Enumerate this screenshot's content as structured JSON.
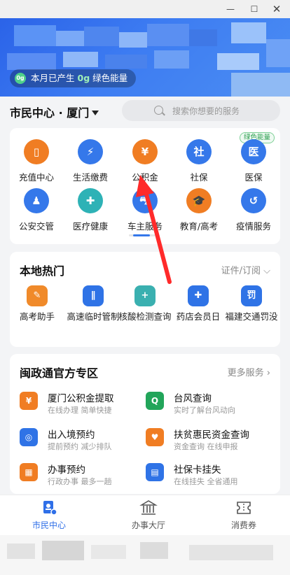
{
  "window": {
    "controls": [
      "minimize",
      "maximize",
      "close"
    ]
  },
  "banner": {
    "energy_text_prefix": "本月已产生",
    "energy_value": "0g",
    "energy_text_suffix": "绿色能量",
    "leaf_label": "0g"
  },
  "location": {
    "city": "市民中心 · 厦门"
  },
  "search": {
    "placeholder": "搜索你想要的服务"
  },
  "services": {
    "badge": "绿色能量",
    "items": [
      {
        "label": "充值中心",
        "icon": "phone-icon",
        "glyph": "▯"
      },
      {
        "label": "生活缴费",
        "icon": "lightning-icon",
        "glyph": "⚡"
      },
      {
        "label": "公积金",
        "icon": "house-yen-icon",
        "glyph": "¥"
      },
      {
        "label": "社保",
        "icon": "shield-icon",
        "glyph": "社"
      },
      {
        "label": "医保",
        "icon": "medical-shield-icon",
        "glyph": "医"
      },
      {
        "label": "公安交管",
        "icon": "police-icon",
        "glyph": "♟"
      },
      {
        "label": "医疗健康",
        "icon": "heart-plus-icon",
        "glyph": "✚"
      },
      {
        "label": "车主服务",
        "icon": "car-icon",
        "glyph": "⛍"
      },
      {
        "label": "教育/高考",
        "icon": "graduation-cap-icon",
        "glyph": "🎓"
      },
      {
        "label": "疫情服务",
        "icon": "clock-refresh-icon",
        "glyph": "↺"
      }
    ]
  },
  "local_hot": {
    "title": "本地热门",
    "filter": "证件/订阅",
    "items": [
      {
        "label": "高考助手",
        "icon": "exam-notes-icon",
        "glyph": "✎"
      },
      {
        "label": "高速临时管制",
        "icon": "highway-icon",
        "glyph": "∥"
      },
      {
        "label": "核酸检测查询",
        "icon": "test-heart-icon",
        "glyph": "+"
      },
      {
        "label": "药店会员日",
        "icon": "pharmacy-icon",
        "glyph": "✚"
      },
      {
        "label": "福建交通罚没",
        "icon": "fine-ticket-icon",
        "glyph": "罚"
      }
    ]
  },
  "official": {
    "title": "闽政通官方专区",
    "more": "更多服务",
    "items": [
      {
        "title": "厦门公积金提取",
        "sub": "在线办理 简单快捷",
        "icon": "provident-fund-icon",
        "glyph": "¥"
      },
      {
        "title": "台风查询",
        "sub": "实时了解台风动向",
        "icon": "typhoon-search-icon",
        "glyph": "Q"
      },
      {
        "title": "出入境预约",
        "sub": "提前预约 减少排队",
        "icon": "passport-icon",
        "glyph": "◎"
      },
      {
        "title": "扶贫惠民资金查询",
        "sub": "资金查询 在线申报",
        "icon": "poverty-aid-icon",
        "glyph": "♥"
      },
      {
        "title": "办事预约",
        "sub": "行政办事 最多一趟",
        "icon": "calendar-icon",
        "glyph": "▦"
      },
      {
        "title": "社保卡挂失",
        "sub": "在线挂失 全省通用",
        "icon": "card-search-icon",
        "glyph": "▤"
      }
    ]
  },
  "tabbar": {
    "tabs": [
      {
        "label": "市民中心",
        "icon": "citizen-center-icon",
        "active": true
      },
      {
        "label": "办事大厅",
        "icon": "government-hall-icon",
        "active": false
      },
      {
        "label": "消费券",
        "icon": "coupon-icon",
        "active": false
      }
    ]
  },
  "colors": {
    "primary": "#3578ea",
    "orange": "#f07d23",
    "annotation": "#ff2a2a"
  }
}
